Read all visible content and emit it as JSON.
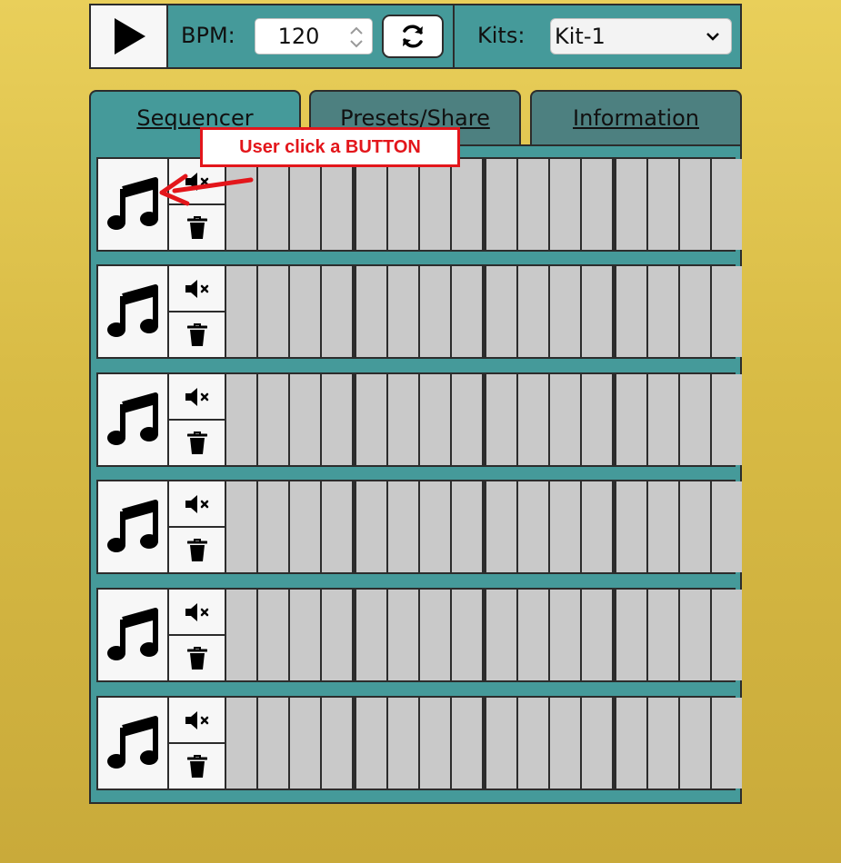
{
  "toolbar": {
    "bpm_label": "BPM:",
    "bpm_value": "120",
    "kits_label": "Kits:",
    "kits_selected": "Kit-1",
    "icons": [
      "play-icon",
      "refresh-icon",
      "spinner-icon",
      "chevron-down-icon"
    ]
  },
  "tabs": [
    {
      "label": "Sequencer",
      "active": true
    },
    {
      "label": "Presets/Share",
      "active": false
    },
    {
      "label": "Information",
      "active": false
    }
  ],
  "sequencer": {
    "track_count": 6,
    "steps_per_track": 16,
    "track_icons": [
      "music-note-icon",
      "mute-icon",
      "trash-icon"
    ]
  },
  "annotation": {
    "text": "User click a BUTTON",
    "color": "#e3161b"
  },
  "colors": {
    "background": "#d8bb45",
    "panel": "#459a9a",
    "inactive_tab": "#4d8080",
    "step_off": "#c9c9c9",
    "border": "#2c2c2c"
  }
}
